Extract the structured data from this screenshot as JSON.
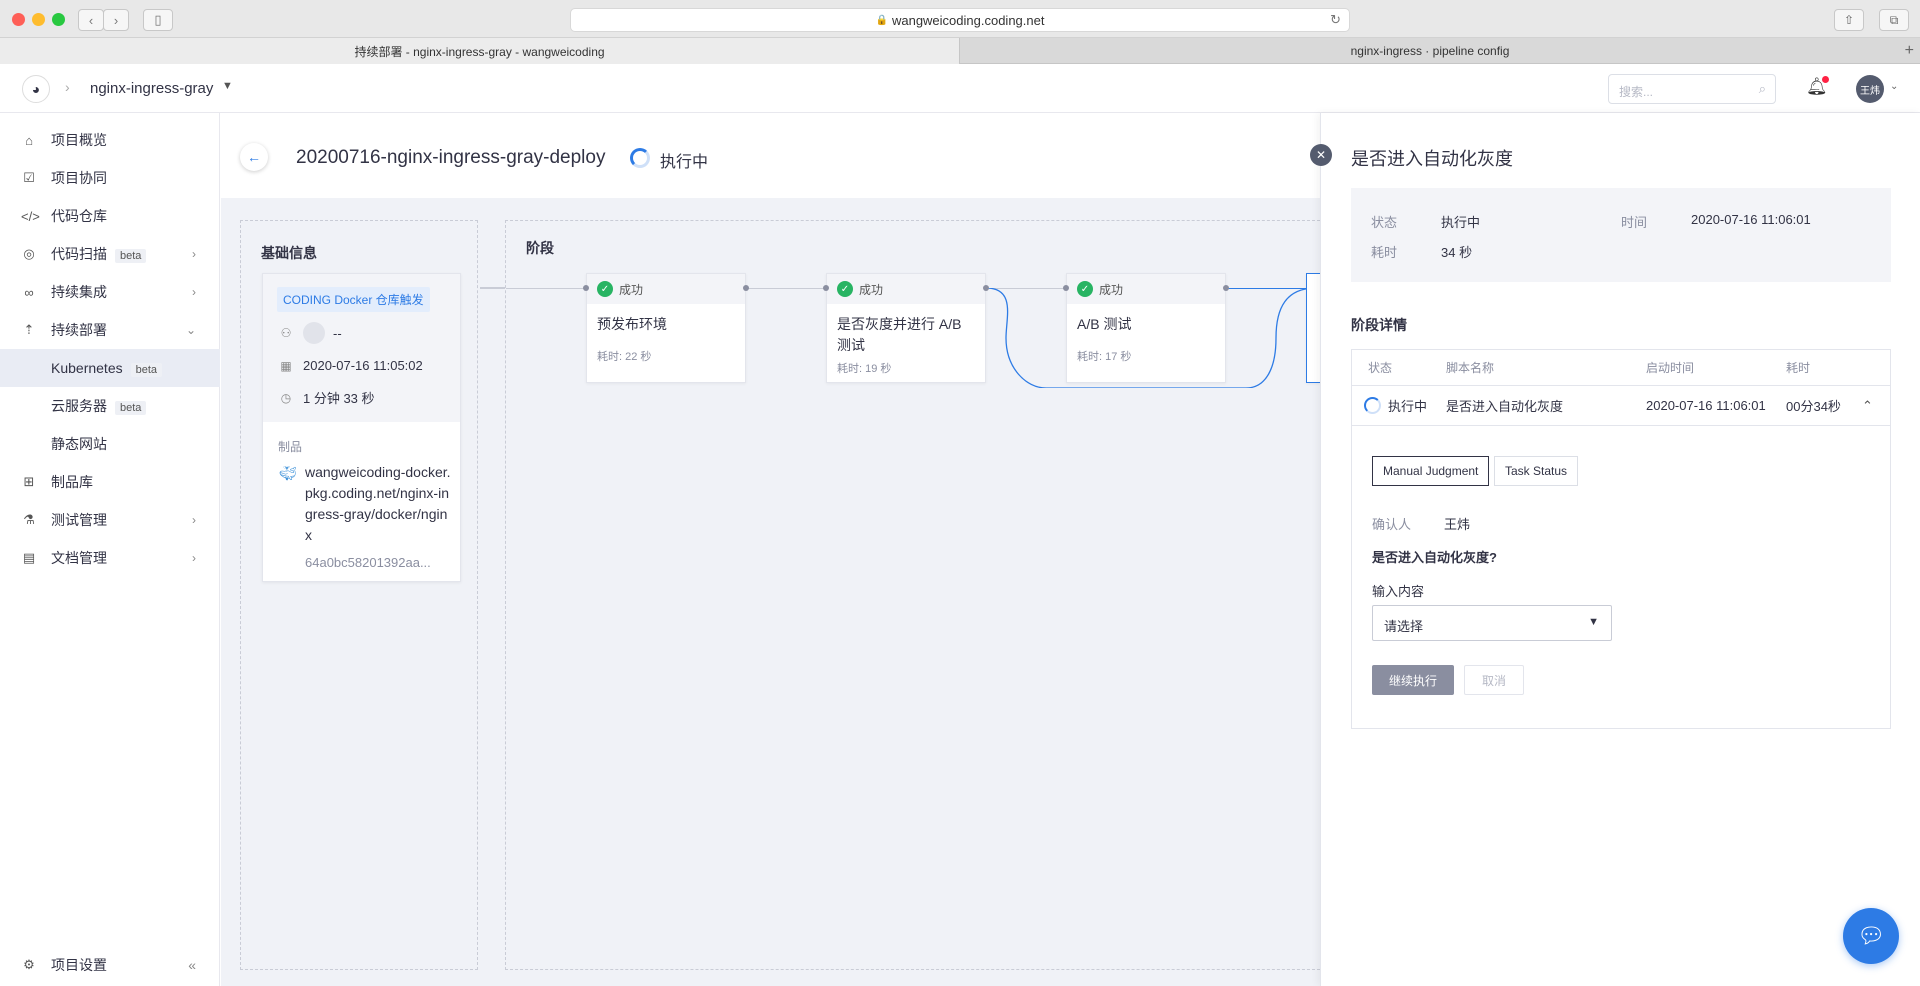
{
  "browser": {
    "url": "wangweicoding.coding.net",
    "tabs": [
      "持续部署 - nginx-ingress-gray - wangweicoding",
      "nginx-ingress · pipeline config"
    ]
  },
  "header": {
    "project": "nginx-ingress-gray",
    "search_placeholder": "搜索...",
    "user_avatar": "王炜"
  },
  "sidebar": {
    "items": [
      {
        "label": "项目概览",
        "icon": "home-icon"
      },
      {
        "label": "项目协同",
        "icon": "checkbox-icon"
      },
      {
        "label": "代码仓库",
        "icon": "code-icon"
      },
      {
        "label": "代码扫描",
        "icon": "scan-icon",
        "beta": "beta"
      },
      {
        "label": "持续集成",
        "icon": "infinity-icon"
      },
      {
        "label": "持续部署",
        "icon": "rocket-icon"
      },
      {
        "label": "Kubernetes",
        "beta": "beta"
      },
      {
        "label": "云服务器",
        "beta": "beta"
      },
      {
        "label": "静态网站"
      },
      {
        "label": "制品库",
        "icon": "package-icon"
      },
      {
        "label": "测试管理",
        "icon": "flask-icon"
      },
      {
        "label": "文档管理",
        "icon": "document-icon"
      }
    ],
    "settings": "项目设置"
  },
  "pipeline": {
    "title": "20200716-nginx-ingress-gray-deploy",
    "status": "执行中"
  },
  "basic": {
    "title": "基础信息",
    "trigger_tag": "CODING Docker 仓库触发",
    "user": "--",
    "time": "2020-07-16 11:05:02",
    "duration": "1 分钟 33 秒",
    "artifact_label": "制品",
    "artifact_path": "wangweicoding-docker.pkg.coding.net/nginx-ingress-gray/docker/nginx",
    "artifact_hash": "64a0bc58201392aa..."
  },
  "stages": {
    "title": "阶段",
    "items": [
      {
        "status": "成功",
        "name": "预发布环境",
        "duration": "耗时: 22 秒"
      },
      {
        "status": "成功",
        "name": "是否灰度并进行 A/B 测试",
        "duration": "耗时: 19 秒"
      },
      {
        "status": "成功",
        "name": "A/B 测试",
        "duration": "耗时: 17 秒"
      }
    ]
  },
  "drawer": {
    "title": "是否进入自动化灰度",
    "status_label": "状态",
    "status_value": "执行中",
    "time_label": "时间",
    "time_value": "2020-07-16 11:06:01",
    "dur_label": "耗时",
    "dur_value": "34 秒",
    "section_title": "阶段详情",
    "table_headers": [
      "状态",
      "脚本名称",
      "启动时间",
      "耗时"
    ],
    "row": {
      "status": "执行中",
      "name": "是否进入自动化灰度",
      "start": "2020-07-16 11:06:01",
      "dur": "00分34秒"
    },
    "tabs": [
      "Manual Judgment",
      "Task Status"
    ],
    "confirmer_label": "确认人",
    "confirmer_value": "王炜",
    "question": "是否进入自动化灰度?",
    "input_label": "输入内容",
    "select_value": "请选择",
    "continue_btn": "继续执行",
    "cancel_btn": "取消"
  },
  "colors": {
    "accent": "#2d7be5",
    "success": "#28b463"
  }
}
